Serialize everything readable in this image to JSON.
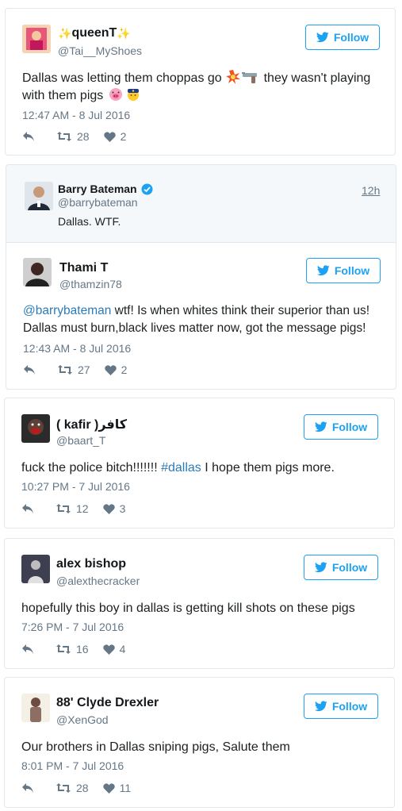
{
  "colors": {
    "accent": "#1da1f2",
    "link": "#2b7bb9",
    "muted": "#657786",
    "border": "#e1e8ed"
  },
  "tweets": [
    {
      "name": "queenT",
      "name_decoration": "sparkles",
      "handle": "@Tai__MyShoes",
      "follow_label": "Follow",
      "text_parts": [
        "Dallas was letting them choppas go",
        " they wasn't playing",
        "with them pigs"
      ],
      "emojis": [
        "collision-icon",
        "pistol-icon",
        "pig-face-icon",
        "police-officer-icon"
      ],
      "timestamp": "12:47 AM - 8 Jul 2016",
      "retweets": "28",
      "likes": "2"
    },
    {
      "quoted": {
        "name": "Barry Bateman",
        "verified": true,
        "handle": "@barrybateman",
        "age": "12h",
        "text": "Dallas. WTF."
      },
      "name": "Thami T",
      "handle": "@thamzin78",
      "follow_label": "Follow",
      "mention": "@barrybateman",
      "text_line1_rest": " wtf! Is when whites think their superior than us!",
      "text_line2": "Dallas must burn,black lives matter now, got the message pigs!",
      "timestamp": "12:43 AM - 8 Jul 2016",
      "retweets": "27",
      "likes": "2"
    },
    {
      "name": "( kafir )كافر",
      "handle": "@baart_T",
      "follow_label": "Follow",
      "text_before": "fuck the police bitch!!!!!!! ",
      "hashtag": "#dallas",
      "text_after": " I hope them pigs more.",
      "timestamp": "10:27 PM - 7 Jul 2016",
      "retweets": "12",
      "likes": "3"
    },
    {
      "name": "alex bishop",
      "handle": "@alexthecracker",
      "follow_label": "Follow",
      "text": "hopefully this boy in dallas is getting kill shots on these pigs",
      "timestamp": "7:26 PM - 7 Jul 2016",
      "retweets": "16",
      "likes": "4"
    },
    {
      "name": "88' Clyde Drexler",
      "handle": "@XenGod",
      "follow_label": "Follow",
      "text": "Our brothers in Dallas sniping pigs, Salute them",
      "timestamp": "8:01 PM - 7 Jul 2016",
      "retweets": "28",
      "likes": "11"
    }
  ]
}
